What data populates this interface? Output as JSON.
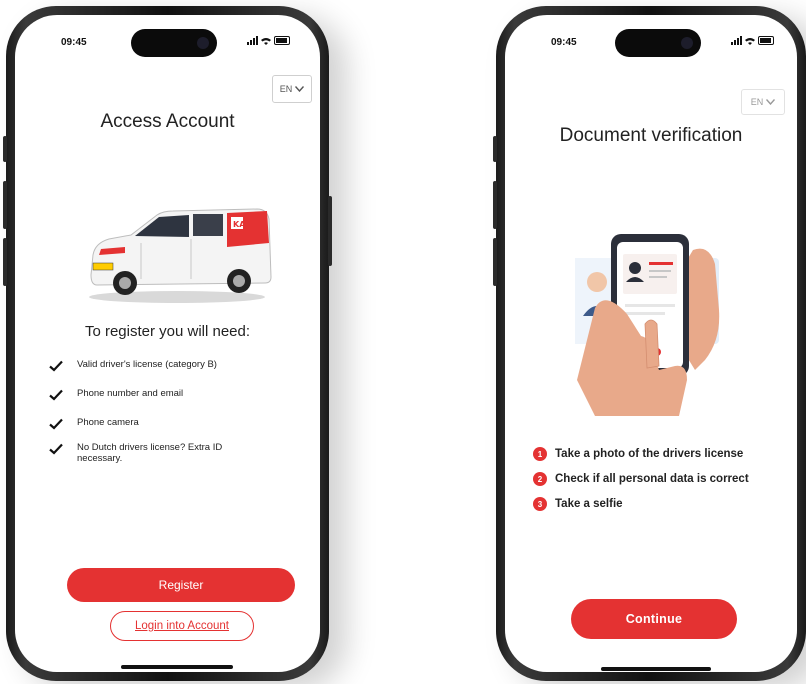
{
  "colors": {
    "accent": "#e43232",
    "frame": "#1c1c1c",
    "screen": "#ffffff"
  },
  "left_phone": {
    "status_time": "09:45",
    "language": "EN",
    "title": "Access Account",
    "subtitle": "To register you will need:",
    "requirements": [
      "Valid driver's license (category B)",
      "Phone number and email",
      "Phone camera",
      "No Dutch drivers license? Extra ID necessary."
    ],
    "register_label": "Register",
    "login_label": "Login into Account"
  },
  "right_phone": {
    "status_time": "09:45",
    "language": "EN",
    "title": "Document verification",
    "steps": [
      {
        "num": "1",
        "text": "Take a photo of the drivers license"
      },
      {
        "num": "2",
        "text": "Check if all personal data is correct"
      },
      {
        "num": "3",
        "text": "Take a selfie"
      }
    ],
    "continue_label": "Continue"
  }
}
